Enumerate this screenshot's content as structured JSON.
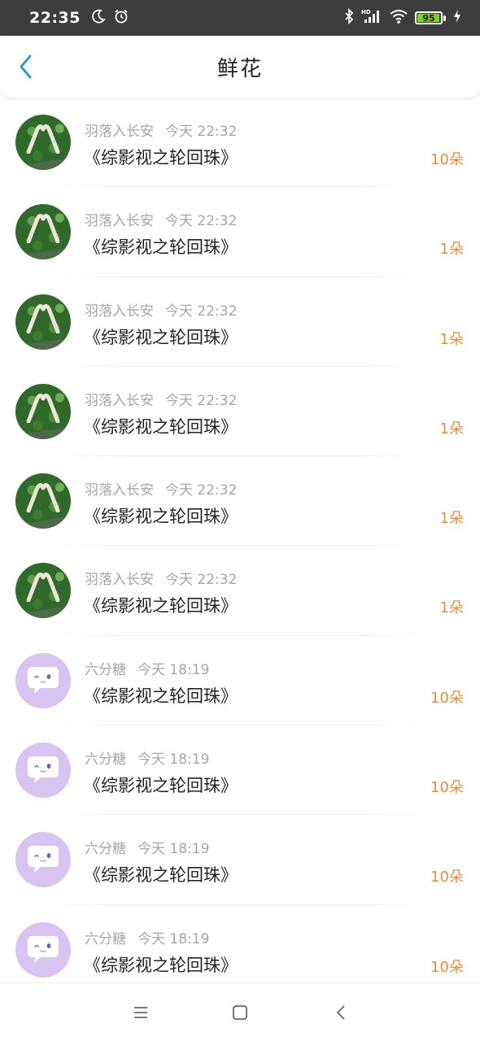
{
  "status_bar": {
    "time": "22:35",
    "battery_level": "95",
    "icons": [
      "moon-icon",
      "alarm-icon",
      "bluetooth-icon",
      "hd-signal-icon",
      "wifi-icon",
      "battery-icon",
      "charging-icon"
    ],
    "battery_color": "#7ed321"
  },
  "header": {
    "title": "鲜花",
    "back_icon": "chevron-left-icon",
    "back_color": "#2b9be8"
  },
  "colors": {
    "count_color": "#ef8b36",
    "meta_color": "#a6a6a6"
  },
  "items": [
    {
      "user": "羽落入长安",
      "time": "今天 22:32",
      "book": "《综影视之轮回珠》",
      "count": "10朵",
      "avatar": "photo"
    },
    {
      "user": "羽落入长安",
      "time": "今天 22:32",
      "book": "《综影视之轮回珠》",
      "count": "1朵",
      "avatar": "photo"
    },
    {
      "user": "羽落入长安",
      "time": "今天 22:32",
      "book": "《综影视之轮回珠》",
      "count": "1朵",
      "avatar": "photo"
    },
    {
      "user": "羽落入长安",
      "time": "今天 22:32",
      "book": "《综影视之轮回珠》",
      "count": "1朵",
      "avatar": "photo"
    },
    {
      "user": "羽落入长安",
      "time": "今天 22:32",
      "book": "《综影视之轮回珠》",
      "count": "1朵",
      "avatar": "photo"
    },
    {
      "user": "羽落入长安",
      "time": "今天 22:32",
      "book": "《综影视之轮回珠》",
      "count": "1朵",
      "avatar": "photo"
    },
    {
      "user": "六分糖",
      "time": "今天 18:19",
      "book": "《综影视之轮回珠》",
      "count": "10朵",
      "avatar": "bubble"
    },
    {
      "user": "六分糖",
      "time": "今天 18:19",
      "book": "《综影视之轮回珠》",
      "count": "10朵",
      "avatar": "bubble"
    },
    {
      "user": "六分糖",
      "time": "今天 18:19",
      "book": "《综影视之轮回珠》",
      "count": "10朵",
      "avatar": "bubble"
    },
    {
      "user": "六分糖",
      "time": "今天 18:19",
      "book": "《综影视之轮回珠》",
      "count": "10朵",
      "avatar": "bubble"
    }
  ],
  "nav_bar": {
    "icons": [
      "menu-icon",
      "home-square-icon",
      "back-triangle-icon"
    ]
  }
}
